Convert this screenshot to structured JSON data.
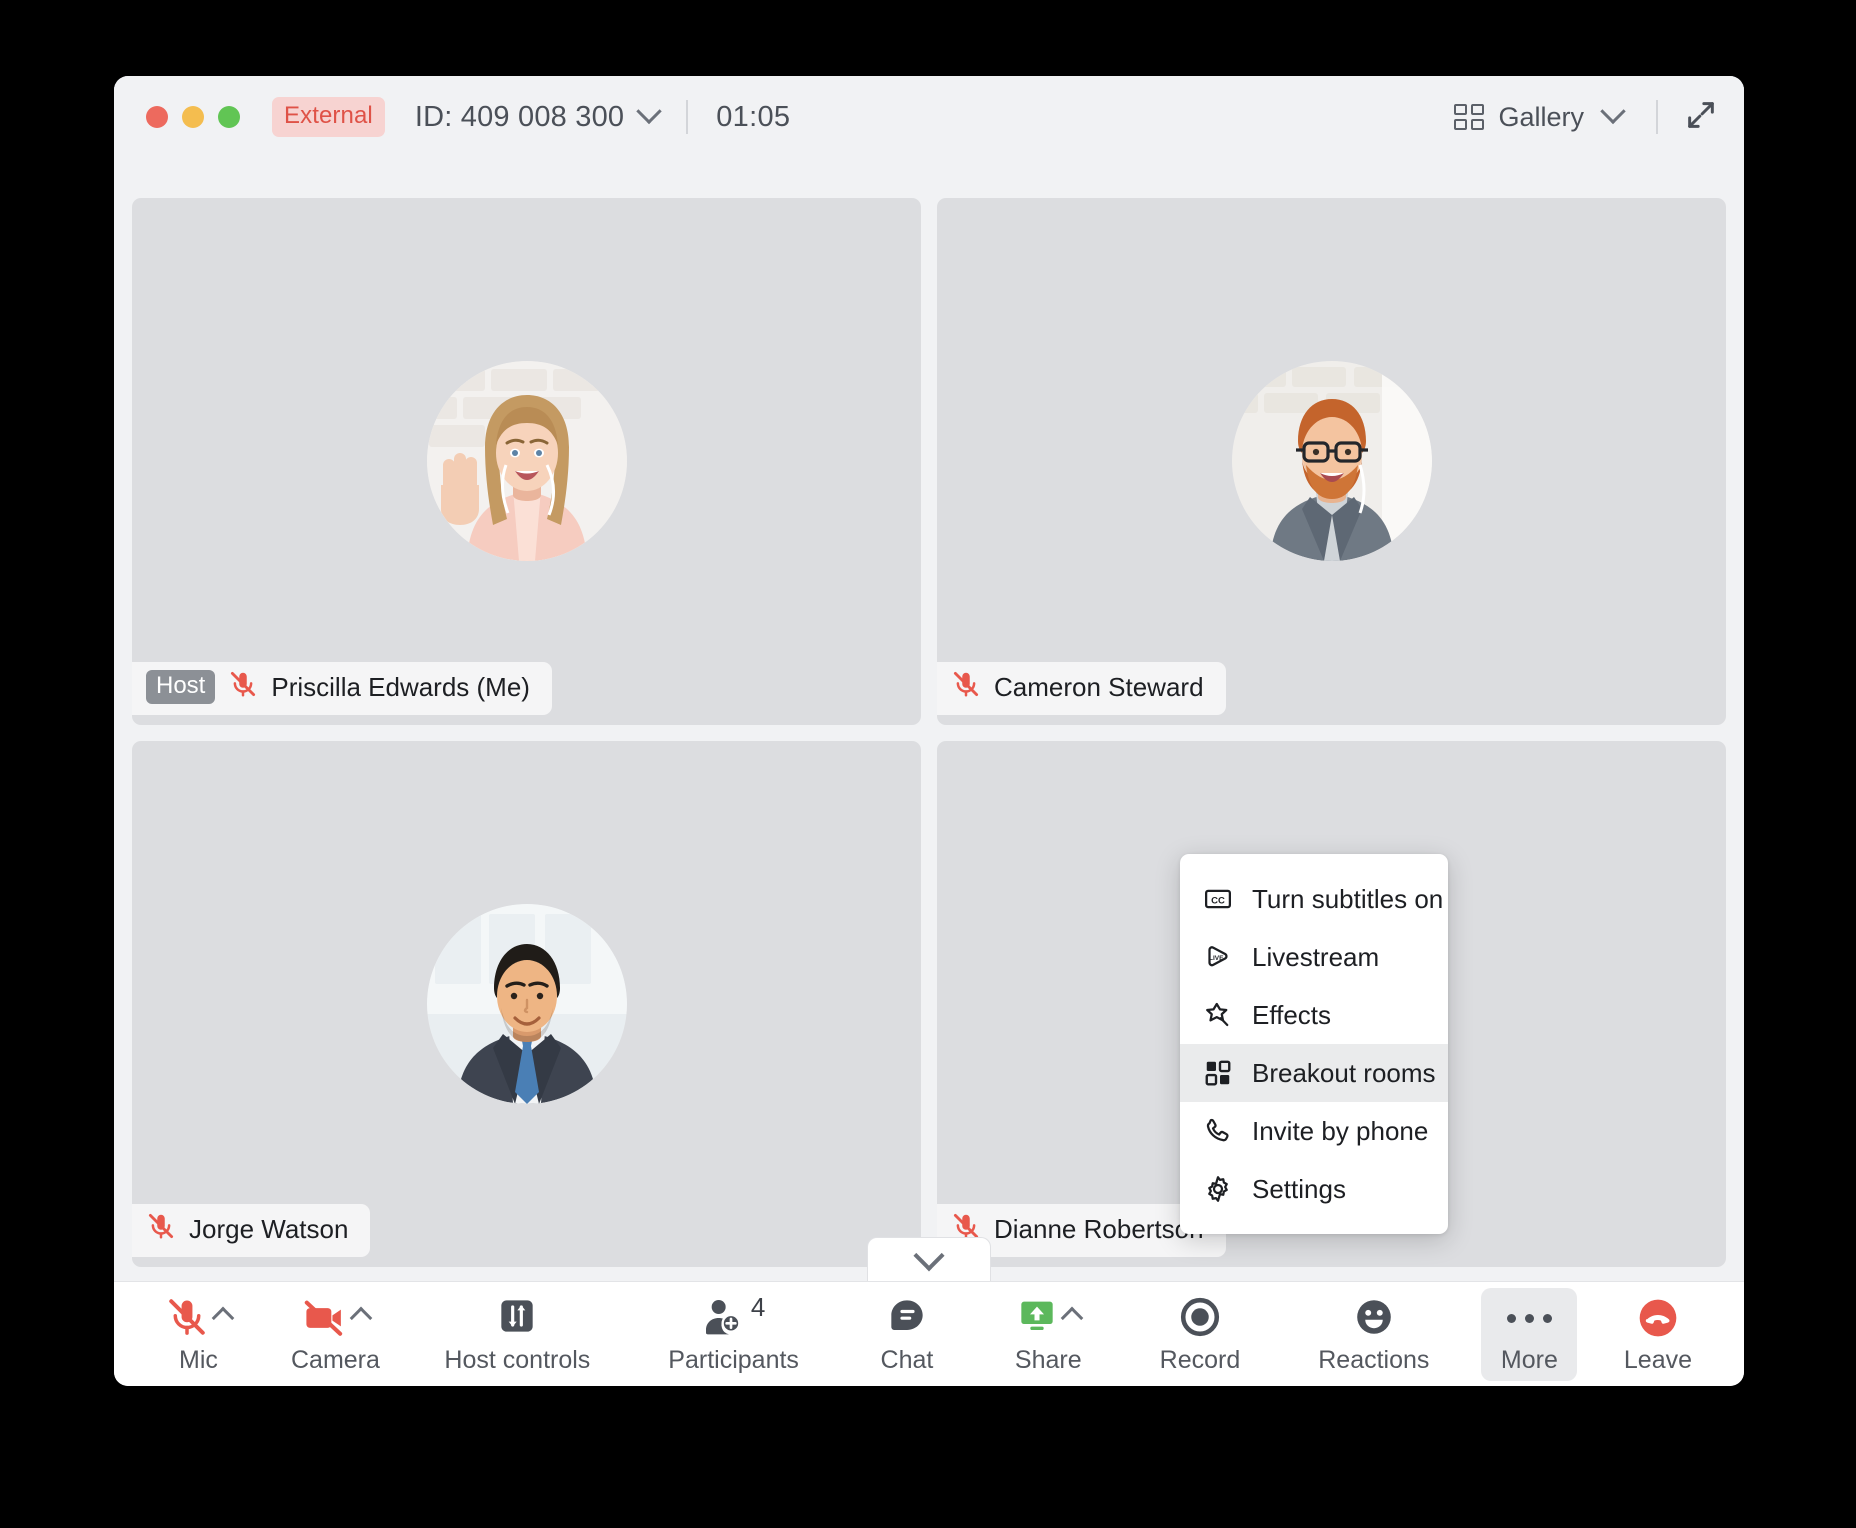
{
  "window": {
    "traffic_lights": [
      "close",
      "minimize",
      "zoom"
    ],
    "external_badge": "External",
    "meeting_id": "ID: 409 008 300",
    "timer": "01:05",
    "view_mode": "Gallery"
  },
  "participants": [
    {
      "name": "Priscilla Edwards (Me)",
      "role_badge": "Host",
      "muted": true,
      "avatar": "woman-waving"
    },
    {
      "name": "Cameron Steward",
      "role_badge": "",
      "muted": true,
      "avatar": "man-glasses-beard"
    },
    {
      "name": "Jorge Watson",
      "role_badge": "",
      "muted": true,
      "avatar": "man-suit-tie"
    },
    {
      "name": "Dianne Robertson",
      "role_badge": "",
      "muted": true,
      "avatar": "hidden-behind-menu"
    }
  ],
  "toolbar": {
    "mic": {
      "label": "Mic",
      "state": "muted",
      "icon": "mic-off-icon",
      "has_caret": true
    },
    "camera": {
      "label": "Camera",
      "state": "off",
      "icon": "video-off-icon",
      "has_caret": true
    },
    "host_controls": {
      "label": "Host controls",
      "icon": "sliders-icon"
    },
    "participants": {
      "label": "Participants",
      "icon": "person-add-icon",
      "count": "4"
    },
    "chat": {
      "label": "Chat",
      "icon": "chat-bubble-icon"
    },
    "share": {
      "label": "Share",
      "icon": "share-screen-icon",
      "has_caret": true,
      "accent": "#5cb85c"
    },
    "record": {
      "label": "Record",
      "icon": "record-circle-icon"
    },
    "reactions": {
      "label": "Reactions",
      "icon": "smiley-icon"
    },
    "more": {
      "label": "More",
      "icon": "ellipsis-icon",
      "active": true
    },
    "leave": {
      "label": "Leave",
      "icon": "hangup-icon",
      "accent": "#e8584c"
    }
  },
  "more_menu": {
    "items": [
      {
        "label": "Turn subtitles on",
        "icon": "cc-icon",
        "highlighted": false
      },
      {
        "label": "Livestream",
        "icon": "live-icon",
        "highlighted": false
      },
      {
        "label": "Effects",
        "icon": "sparkle-star-icon",
        "highlighted": false
      },
      {
        "label": "Breakout rooms",
        "icon": "grid-squares-icon",
        "highlighted": true
      },
      {
        "label": "Invite by phone",
        "icon": "phone-icon",
        "highlighted": false
      },
      {
        "label": "Settings",
        "icon": "gear-icon",
        "highlighted": false
      }
    ]
  },
  "colors": {
    "danger": "#e8584c",
    "external_badge_bg": "#f7d3d1",
    "external_badge_fg": "#df5247",
    "share_green": "#5cb85c",
    "tile_bg": "#dcdde0",
    "window_bg": "#f1f2f4"
  }
}
